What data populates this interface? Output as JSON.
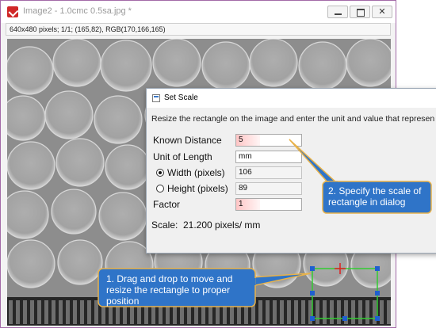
{
  "window": {
    "title": "Image2 - 1.0cmc 0.5sa.jpg *",
    "info": "640x480 pixels; 1/1; (165,82), RGB(170,166,165)",
    "close_glyph": "✕"
  },
  "dialog": {
    "title": "Set Scale",
    "description": "Resize the rectangle on the image and enter the unit and value that represen",
    "known_distance": {
      "label": "Known Distance",
      "value": "5"
    },
    "unit_of_length": {
      "label": "Unit of Length",
      "value": "mm"
    },
    "width": {
      "label": "Width (pixels)",
      "value": "106",
      "selected": true
    },
    "height": {
      "label": "Height (pixels)",
      "value": "89",
      "selected": false
    },
    "factor": {
      "label": "Factor",
      "value": "1"
    },
    "scale": {
      "label": "Scale:",
      "value": "21.200  pixels/ mm"
    }
  },
  "callouts": {
    "dialog_note": "2. Specify the scale of rectangle in dialog",
    "drag_note": "1. Drag and drop to move and resize the rectangle to proper position"
  },
  "colors": {
    "window_border": "#a36aa8",
    "callout_fill": "#2f74c8",
    "callout_border": "#e8b24a",
    "selection_rect": "#33cc33",
    "selection_handle": "#1f5fd0",
    "selection_center": "#e02020"
  }
}
